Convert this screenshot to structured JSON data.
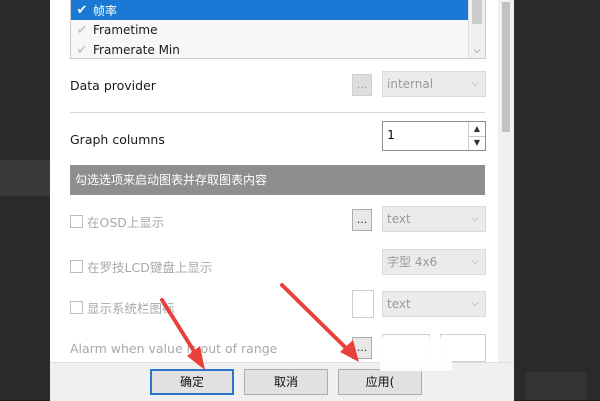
{
  "metrics_list": {
    "items": [
      {
        "label": "帧率",
        "checked": true,
        "selected": true
      },
      {
        "label": "Frametime",
        "checked": false,
        "selected": false
      },
      {
        "label": "Framerate Min",
        "checked": false,
        "selected": false
      }
    ]
  },
  "data_provider": {
    "label": "Data provider",
    "button_label": "...",
    "value": "internal"
  },
  "graph_columns": {
    "label": "Graph columns",
    "value": "1"
  },
  "section": {
    "header": "勾选选项来启动图表并存取图表内容"
  },
  "options": [
    {
      "label": "在OSD上显示",
      "button_label": "...",
      "value": "text"
    },
    {
      "label": "在罗技LCD键盘上显示",
      "value": "字型 4x6"
    },
    {
      "label": "显示系统栏图标",
      "value": "text"
    }
  ],
  "alarm": {
    "label": "Alarm when value is out of range",
    "button_label": "..."
  },
  "buttons": {
    "ok": "确定",
    "cancel": "取消",
    "apply": "应用("
  },
  "colors": {
    "accent": "#1979d4",
    "annotation_arrow": "#e8413b",
    "section_header": "#8e8e8e"
  },
  "icons": {
    "check": "✔",
    "chevron_down": "⌵",
    "spin_up": "▲",
    "spin_down": "▼"
  }
}
